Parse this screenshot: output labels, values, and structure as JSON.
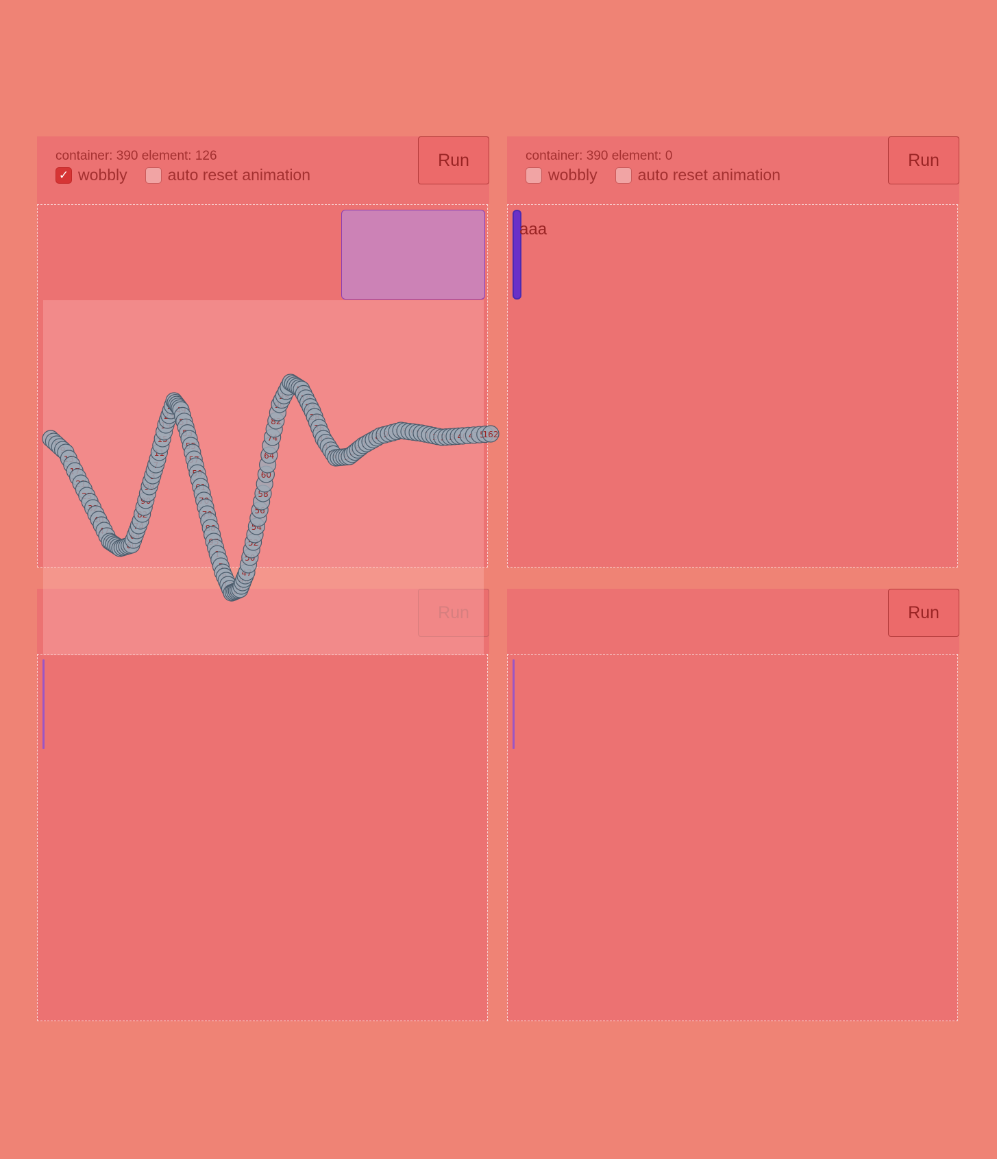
{
  "panels": [
    {
      "stats": "container: 390 element: 126",
      "options": [
        {
          "label": "wobbly",
          "checked": true
        },
        {
          "label": "auto reset animation",
          "checked": false
        }
      ],
      "run_label": "Run",
      "element_text": ""
    },
    {
      "stats": "container: 390 element: 0",
      "options": [
        {
          "label": "wobbly",
          "checked": false
        },
        {
          "label": "auto reset animation",
          "checked": false
        }
      ],
      "run_label": "Run",
      "element_text": "aaa"
    },
    {
      "run_label": "Run"
    },
    {
      "run_label": "Run"
    }
  ],
  "trace": {
    "last_label": "162",
    "labels": [
      "1",
      "3",
      "5",
      "7",
      "9",
      "11",
      "13",
      "15",
      "17",
      "19",
      "21",
      "23",
      "25",
      "28",
      "32",
      "36",
      "40",
      "44",
      "47",
      "49",
      "50",
      "51",
      "52",
      "53",
      "54",
      "55",
      "56",
      "57",
      "58",
      "59",
      "60",
      "61",
      "64",
      "70",
      "74",
      "79",
      "82",
      "86",
      "90",
      "95",
      "99"
    ]
  }
}
